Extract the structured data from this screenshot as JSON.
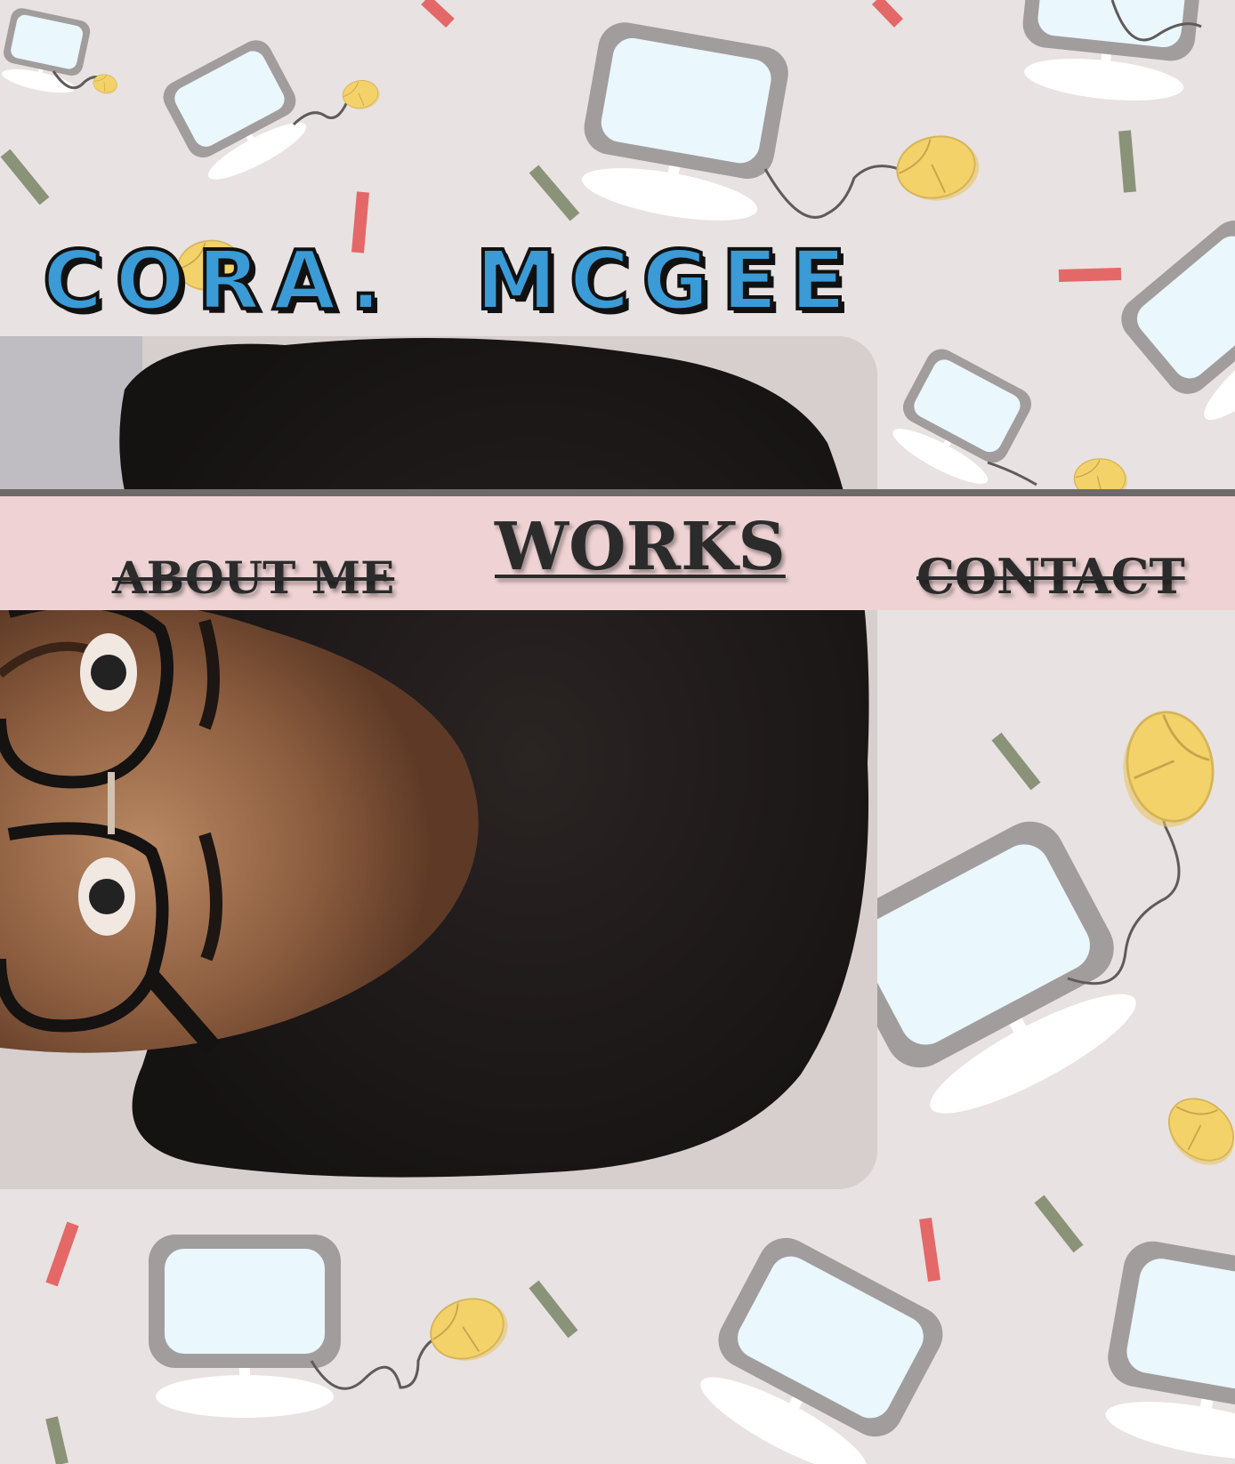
{
  "site": {
    "title": "CORA.  MCGEE"
  },
  "nav": {
    "items": [
      {
        "label": "ABOUT ME"
      },
      {
        "label": "WORKS"
      },
      {
        "label": "CONTACT"
      }
    ]
  },
  "colors": {
    "background": "#e8e2e2",
    "title_fill": "#3a9bd6",
    "nav_band": "#efd3d4",
    "nav_text": "#2b2b2b",
    "screen": "#eaf7fc",
    "monitor_frame": "#a29d9d",
    "mouse": "#f3d26a",
    "confetti_red": "#e46868",
    "confetti_green": "#8a9378"
  },
  "icons": [
    "computer-monitor-icon",
    "computer-mouse-icon",
    "confetti-stick"
  ]
}
